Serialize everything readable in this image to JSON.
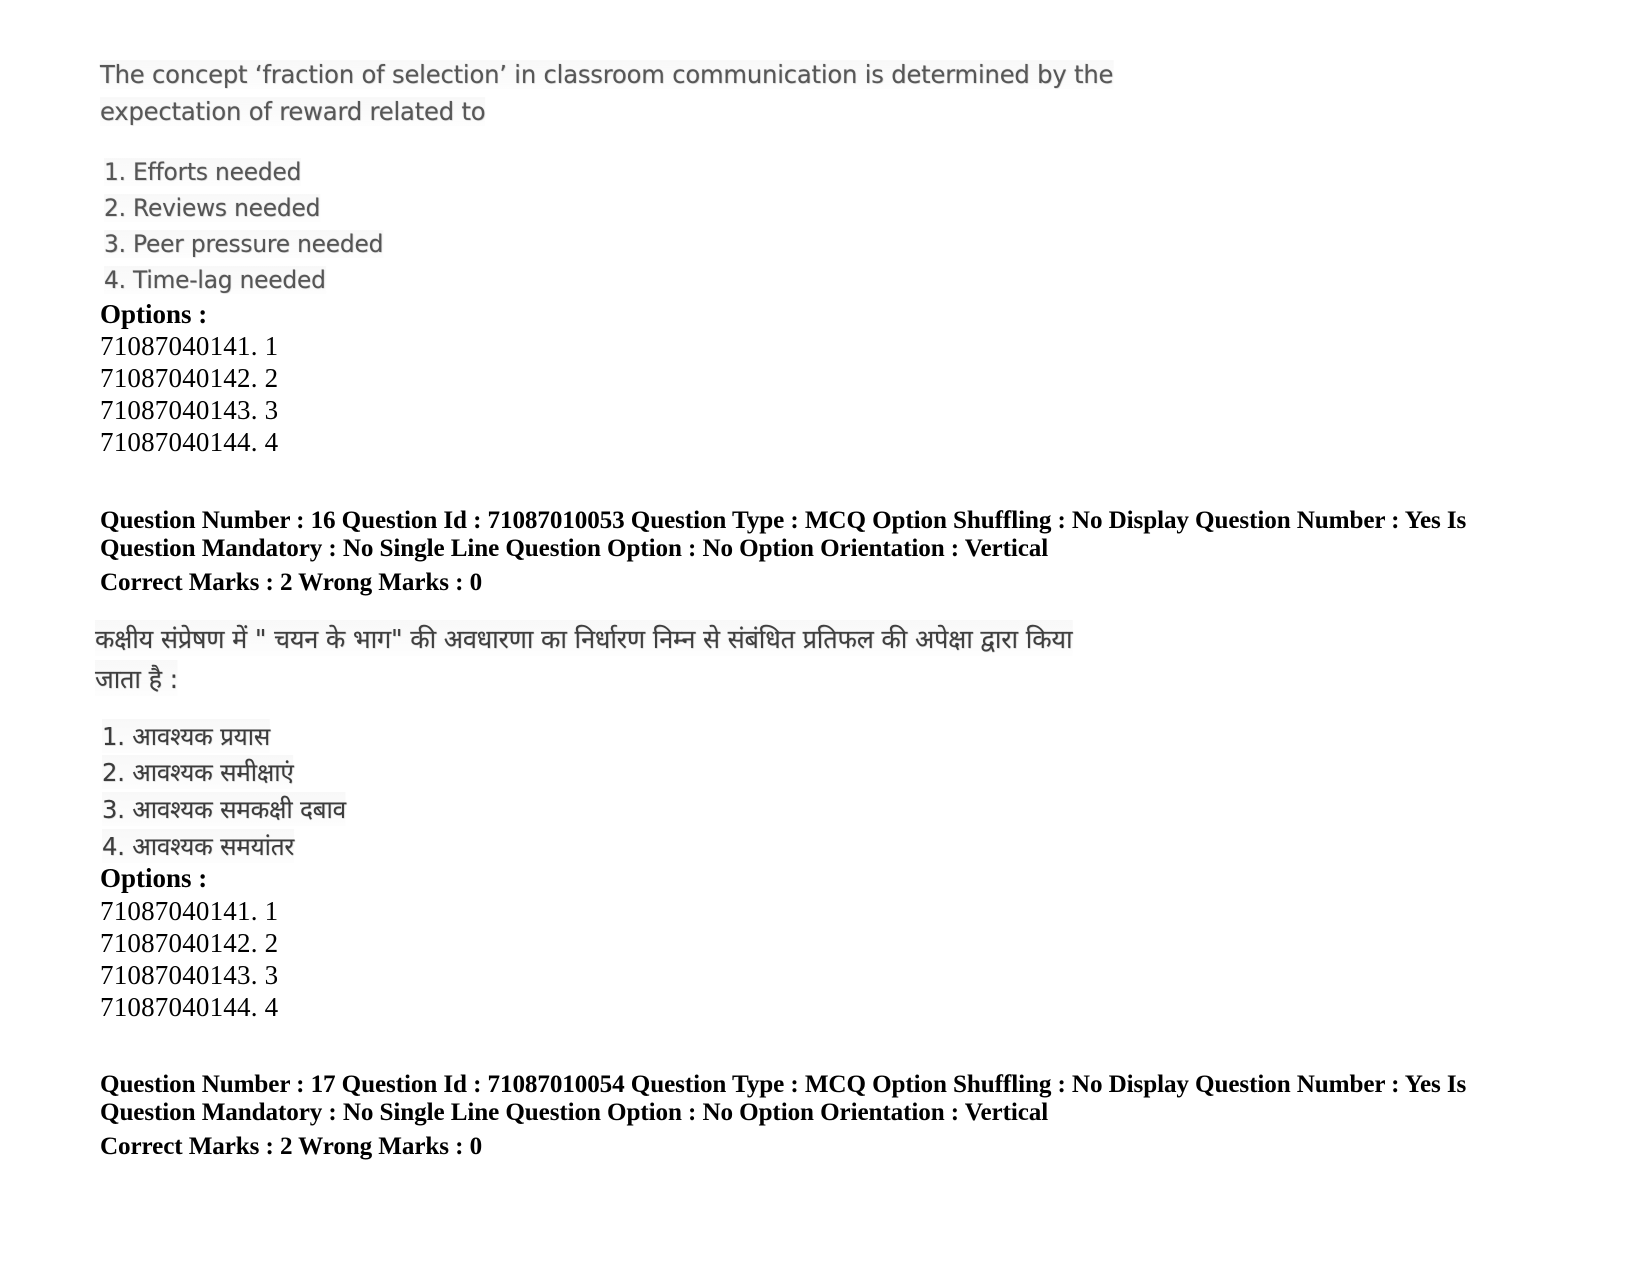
{
  "document": {
    "type": "scanned-exam-question-paper",
    "background_color": "#ffffff",
    "text_color_scanned": "#575757",
    "text_color_digital": "#000000"
  },
  "question_16": {
    "english": {
      "stem_line_1": "The concept ‘fraction of selection’ in classroom communication is determined by the",
      "stem_line_2": "expectation of reward related to",
      "choices": [
        "1. Efforts needed",
        "2. Reviews needed",
        "3. Peer pressure needed",
        "4. Time-lag needed"
      ]
    },
    "options_label": "Options :",
    "option_ids": [
      "71087040141. 1",
      "71087040142. 2",
      "71087040143. 3",
      "71087040144. 4"
    ]
  },
  "meta_16": {
    "line_1": "Question Number : 16 Question Id : 71087010053 Question Type : MCQ Option Shuffling : No Display Question Number : Yes Is",
    "line_2": "Question Mandatory : No Single Line Question Option : No Option Orientation : Vertical",
    "line_3": "Correct Marks : 2 Wrong Marks : 0",
    "question_number": "16",
    "question_id": "71087010053",
    "question_type": "MCQ",
    "option_shuffling": "No",
    "display_question_number": "Yes",
    "is_question_mandatory": "No",
    "single_line_question_option": "No",
    "option_orientation": "Vertical",
    "correct_marks": "2",
    "wrong_marks": "0"
  },
  "question_16_hindi": {
    "stem_line_1": "कक्षीय संप्रेषण में \" चयन के भाग\" की अवधारणा का निर्धारण निम्न से संबंधित प्रतिफल की अपेक्षा द्वारा किया",
    "stem_line_2": "जाता है :",
    "choices": [
      "1. आवश्यक प्रयास",
      "2. आवश्यक समीक्षाएं",
      "3. आवश्यक समकक्षी दबाव",
      "4. आवश्यक समयांतर"
    ],
    "options_label": "Options :",
    "option_ids": [
      "71087040141. 1",
      "71087040142. 2",
      "71087040143. 3",
      "71087040144. 4"
    ]
  },
  "meta_17": {
    "line_1": "Question Number : 17 Question Id : 71087010054 Question Type : MCQ Option Shuffling : No Display Question Number : Yes Is",
    "line_2": "Question Mandatory : No Single Line Question Option : No Option Orientation : Vertical",
    "line_3": "Correct Marks : 2 Wrong Marks : 0",
    "question_number": "17",
    "question_id": "71087010054",
    "question_type": "MCQ",
    "option_shuffling": "No",
    "display_question_number": "Yes",
    "is_question_mandatory": "No",
    "single_line_question_option": "No",
    "option_orientation": "Vertical",
    "correct_marks": "2",
    "wrong_marks": "0"
  }
}
